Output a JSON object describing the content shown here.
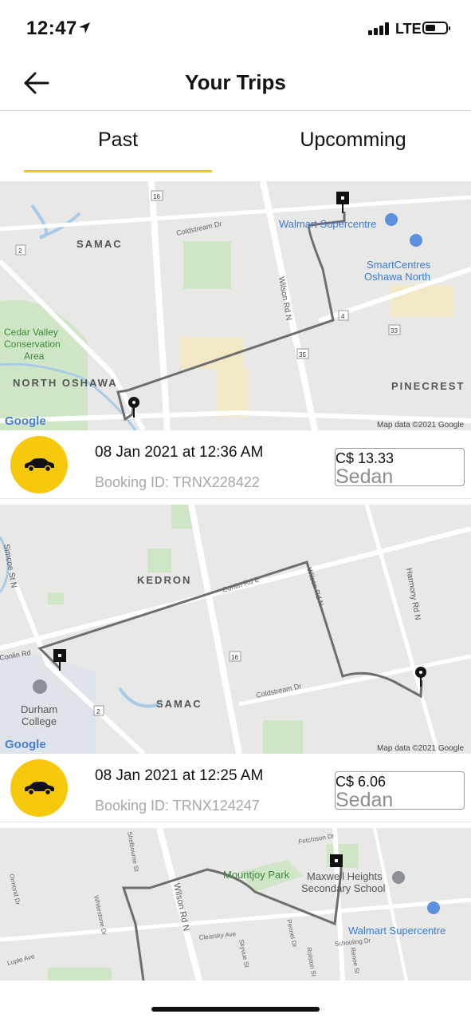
{
  "status_bar": {
    "time": "12:47",
    "network": "LTE"
  },
  "header": {
    "title": "Your Trips"
  },
  "tabs": [
    {
      "label": "Past",
      "active": true
    },
    {
      "label": "Upcomming",
      "active": false
    }
  ],
  "colors": {
    "accent": "#F7C80B",
    "route": "#6e6e6e",
    "map_bg": "#E8E8E6",
    "park": "#CFE6C6"
  },
  "trips": [
    {
      "date": "08 Jan 2021 at 12:36 AM",
      "booking_id": "Booking ID: TRNX228422",
      "fare": "C$ 13.33",
      "vehicle": "Sedan",
      "map": {
        "labels": [
          "SAMAC",
          "Coldstream Dr",
          "Walmart Supercentre",
          "SmartCentres",
          "Oshawa North",
          "Wilson Rd N",
          "Cedar Valley",
          "Conservation",
          "Area",
          "NORTH OSHAWA",
          "PINECREST",
          "16",
          "2",
          "4",
          "35",
          "33"
        ],
        "attribution": "Map data ©2021 Google",
        "logo": "Google"
      }
    },
    {
      "date": "08 Jan 2021 at 12:25 AM",
      "booking_id": "Booking ID: TRNX124247",
      "fare": "C$ 6.06",
      "vehicle": "Sedan",
      "map": {
        "labels": [
          "KEDRON",
          "Conlin Rd E",
          "Simcoe St N",
          "Wilson Rd N",
          "Harmony Rd N",
          "Conlin Rd",
          "Durham",
          "College",
          "SAMAC",
          "Coldstream Dr",
          "16",
          "2"
        ],
        "attribution": "Map data ©2021 Google",
        "logo": "Google"
      }
    },
    {
      "map": {
        "labels": [
          "Mountjoy Park",
          "Maxwell Heights",
          "Secondary School",
          "Walmart Supercentre",
          "Wilson Rd N",
          "Fetchison Dr",
          "Ormond Dr",
          "Whitestone Dr",
          "Clearsky Ave",
          "Schooling Dr",
          "Luple Ave",
          "Pennel Dr",
          "Skyvue St",
          "Renoe St",
          "Rolston St",
          "Shelbourne St"
        ]
      }
    }
  ]
}
